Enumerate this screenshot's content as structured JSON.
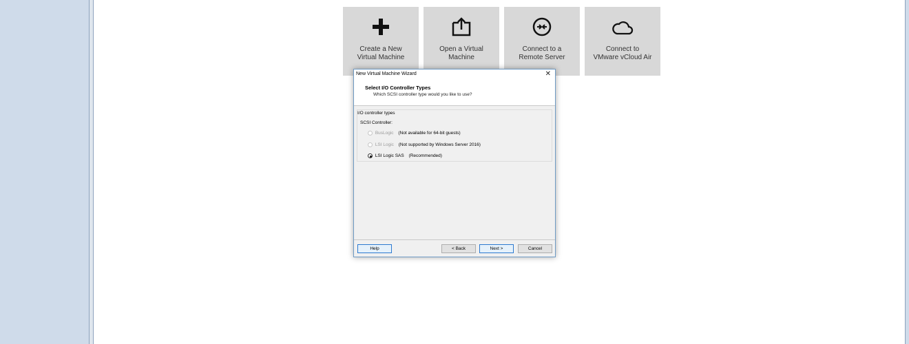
{
  "tiles": [
    {
      "label": "Create a New\nVirtual Machine",
      "icon": "plus-icon"
    },
    {
      "label": "Open a Virtual\nMachine",
      "icon": "open-folder-icon"
    },
    {
      "label": "Connect to a\nRemote Server",
      "icon": "remote-server-icon"
    },
    {
      "label": "Connect to\nVMware vCloud Air",
      "icon": "cloud-icon"
    }
  ],
  "dialog": {
    "title": "New Virtual Machine Wizard",
    "close": "✕",
    "heading": "Select I/O Controller Types",
    "subheading": "Which SCSI controller type would you like to use?",
    "group_label": "I/O controller types",
    "scsi_label": "SCSI Controller:",
    "options": [
      {
        "label": "BusLogic",
        "note": "(Not available for 64-bit guests)",
        "enabled": false,
        "selected": false
      },
      {
        "label": "LSI Logic",
        "note": "(Not supported by Windows Server 2016)",
        "enabled": false,
        "selected": false
      },
      {
        "label": "LSI Logic SAS",
        "note": "(Recommended)",
        "enabled": true,
        "selected": true
      }
    ],
    "buttons": {
      "help": "Help",
      "back": "< Back",
      "next": "Next >",
      "cancel": "Cancel"
    }
  }
}
